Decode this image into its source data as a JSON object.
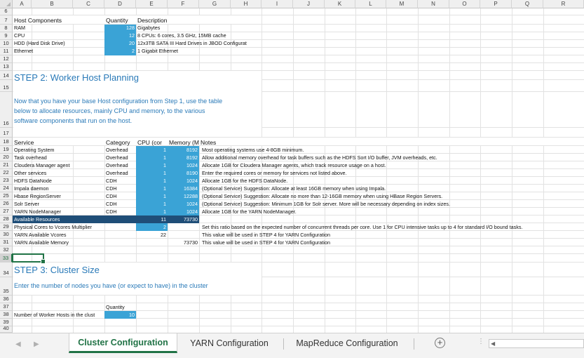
{
  "columns": [
    "A",
    "B",
    "C",
    "D",
    "E",
    "F",
    "G",
    "H",
    "I",
    "J",
    "K",
    "L",
    "M",
    "N",
    "O",
    "P",
    "Q",
    "R"
  ],
  "rows": [
    "6",
    "7",
    "8",
    "9",
    "10",
    "11",
    "12",
    "13",
    "14",
    "15",
    "16",
    "17",
    "18",
    "19",
    "20",
    "21",
    "22",
    "23",
    "24",
    "25",
    "26",
    "27",
    "28",
    "29",
    "30",
    "31",
    "32",
    "33",
    "34",
    "35",
    "36",
    "37",
    "38",
    "39",
    "40"
  ],
  "host_components": {
    "header": {
      "component": "Host Components",
      "quantity": "Quantity",
      "description": "Description"
    },
    "items": [
      {
        "name": "RAM",
        "qty": "128",
        "desc": "Gigabytes"
      },
      {
        "name": "CPU",
        "qty": "12",
        "desc": "8 CPUs: 6 cores, 3.5 GHz, 15MB cache"
      },
      {
        "name": "HDD (Hard Disk Drive)",
        "qty": "20",
        "desc": "12x3TB SATA III Hard Drives in JBOD Configurat"
      },
      {
        "name": "Ethernet",
        "qty": "2",
        "desc": "1 Gigabit Ethernet"
      }
    ]
  },
  "step2": {
    "title": "STEP 2: Worker Host Planning",
    "para_lines": [
      "Now that you have your base Host configuration from Step 1, use the table",
      "below to allocate resources, mainly CPU and memory, to the various",
      "software components that run on the host."
    ]
  },
  "services": {
    "header": {
      "service": "Service",
      "category": "Category",
      "cpu": "CPU (cor",
      "memory": "Memory (M",
      "notes": "Notes"
    },
    "items": [
      {
        "name": "Operating System",
        "cat": "Overhead",
        "cpu": "1",
        "mem": "8192",
        "note": "Most operating systems use 4-8GB minimum."
      },
      {
        "name": "Task overhead",
        "cat": "Overhead",
        "cpu": "1",
        "mem": "8192",
        "note": "Allow additional memory overhead for task buffers such as the HDFS Sort I/O buffer,  JVM overheads, etc."
      },
      {
        "name": "Cloudera Manager agent",
        "cat": "Overhead",
        "cpu": "1",
        "mem": "1024",
        "note": "Allocate 1GB for Cloudera Manager agents, which track resource usage on a host."
      },
      {
        "name": "Other services",
        "cat": "Overhead",
        "cpu": "1",
        "mem": "8190",
        "note": "Enter the required cores or memory for services not listed above."
      },
      {
        "name": "HDFS DataNode",
        "cat": "CDH",
        "cpu": "1",
        "mem": "1024",
        "note": "Allocate 1GB for the HDFS DataNode."
      },
      {
        "name": "Impala daemon",
        "cat": "CDH",
        "cpu": "1",
        "mem": "16384",
        "note": "(Optional Service) Suggestion: Allocate at least 16GB memory when using Impala."
      },
      {
        "name": "Hbase RegionServer",
        "cat": "CDH",
        "cpu": "1",
        "mem": "12288",
        "note": "(Optional Service) Suggestion: Allocate no more than 12-16GB memory when using HBase Region Servers."
      },
      {
        "name": "Solr Server",
        "cat": "CDH",
        "cpu": "1",
        "mem": "1024",
        "note": "(Optional Service) Suggestion: Minimum 1GB for Solr server.  More will be necessary depending on index sizes."
      },
      {
        "name": "YARN NodeManager",
        "cat": "CDH",
        "cpu": "1",
        "mem": "1024",
        "note": "Allocate 1GB for the YARN NodeManager."
      }
    ],
    "available": {
      "label": "Available Resources",
      "cpu": "11",
      "mem": "73730"
    },
    "multiplier": {
      "label": "Physical Cores to Vcores Multiplier",
      "value": "2",
      "note": "Set this ratio based on the expected number of concurrent threads per core.  Use 1 for CPU intensive tasks up to 4 for standard I/O bound tasks."
    },
    "vcores": {
      "label": "YARN Available Vcores",
      "value": "22",
      "note": "This value will be used in STEP 4 for YARN Configuration"
    },
    "memory": {
      "label": "YARN Available Memory",
      "value": "73730",
      "note": "This value will be used in STEP 4 for YARN Configuration"
    }
  },
  "step3": {
    "title": "STEP 3: Cluster Size",
    "para": "Enter the number of nodes you have (or expect to have) in the cluster",
    "qty_header": "Quantity",
    "worker_label": "Number of Worker Hosts in the clust",
    "worker_value": "10"
  },
  "tabs": [
    {
      "label": "Cluster Configuration",
      "active": true
    },
    {
      "label": "YARN Configuration",
      "active": false
    },
    {
      "label": "MapReduce Configuration",
      "active": false
    }
  ],
  "add_sheet": "+",
  "colors": {
    "accent": "#217346",
    "cell_blue": "#3aa3d6",
    "navy": "#1f4e78",
    "heading_blue": "#2a7ab8"
  }
}
